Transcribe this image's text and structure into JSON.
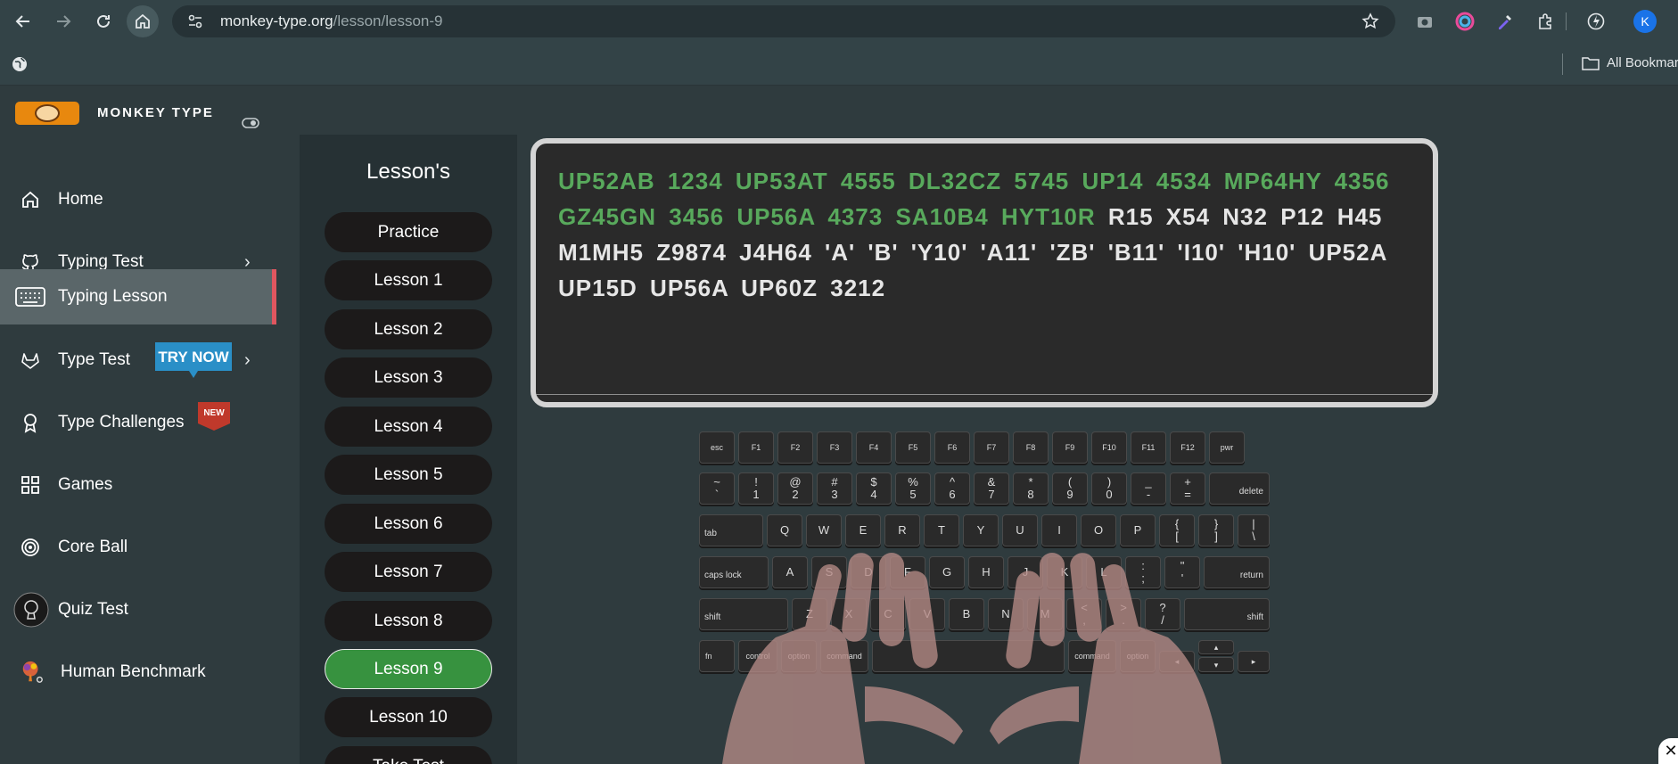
{
  "browser": {
    "url_host": "monkey-type.org",
    "url_path": "/lesson/lesson-9",
    "bookmarks_label": "All Bookmarks",
    "profile_initial": "K"
  },
  "sidebar": {
    "brand": "MONKEY TYPE",
    "items": [
      {
        "label": "Home",
        "icon": "home-icon"
      },
      {
        "label": "Typing Test",
        "icon": "github-icon",
        "has_chevron": true
      },
      {
        "label": "Typing Lesson",
        "icon": "keyboard-icon",
        "active": true
      },
      {
        "label": "Type Test",
        "icon": "gitlab-icon",
        "has_chevron": true,
        "badge": "TRY NOW"
      },
      {
        "label": "Type Challenges",
        "icon": "award-icon",
        "badge": "NEW"
      },
      {
        "label": "Games",
        "icon": "grid-icon"
      },
      {
        "label": "Core Ball",
        "icon": "target-icon"
      },
      {
        "label": "Quiz Test",
        "icon": "quiz-avatar-icon"
      },
      {
        "label": "Human Benchmark",
        "icon": "brain-icon"
      }
    ]
  },
  "lessons": {
    "title": "Lesson's",
    "buttons": [
      "Practice",
      "Lesson 1",
      "Lesson 2",
      "Lesson 3",
      "Lesson 4",
      "Lesson 5",
      "Lesson 6",
      "Lesson 7",
      "Lesson 8",
      "Lesson 9",
      "Lesson 10",
      "Take Test"
    ],
    "active": "Lesson 9"
  },
  "typing": {
    "typed": "UP52AB 1234 UP53AT 4555 DL32CZ 5745 UP14 4534 MP64HY 4356 GZ45GN 3456 UP56A 4373 SA10B4 HYT10R",
    "remaining": " R15 X54 N32 P12 H45 M1MH5 Z9874 J4H64 'A' 'B' 'Y10' 'A11' 'ZB' 'B11' 'I10' 'H10' UP52A UP15D UP56A UP60Z 3212"
  },
  "keyboard": {
    "function_row": [
      "esc",
      "F1",
      "F2",
      "F3",
      "F4",
      "F5",
      "F6",
      "F7",
      "F8",
      "F9",
      "F10",
      "F11",
      "F12",
      "pwr"
    ],
    "number_row": [
      [
        "~",
        "`"
      ],
      [
        "!",
        "1"
      ],
      [
        "@",
        "2"
      ],
      [
        "#",
        "3"
      ],
      [
        "$",
        "4"
      ],
      [
        "%",
        "5"
      ],
      [
        "^",
        "6"
      ],
      [
        "&",
        "7"
      ],
      [
        "*",
        "8"
      ],
      [
        "(",
        "9"
      ],
      [
        ")",
        "0"
      ],
      [
        "_",
        "-"
      ],
      [
        "+",
        "="
      ]
    ],
    "delete": "delete",
    "tab": "tab",
    "qwerty_row": [
      "Q",
      "W",
      "E",
      "R",
      "T",
      "Y",
      "U",
      "I",
      "O",
      "P"
    ],
    "qwerty_extra": [
      [
        "{",
        "["
      ],
      [
        "}",
        "]"
      ],
      [
        "|",
        "\\"
      ]
    ],
    "caps": "caps lock",
    "home_row": [
      "A",
      "S",
      "D",
      "F",
      "G",
      "H",
      "J",
      "K",
      "L"
    ],
    "home_extra": [
      [
        ":",
        ";"
      ],
      [
        "\"",
        "'"
      ]
    ],
    "return": "return",
    "shift": "shift",
    "bottom_letters": [
      "Z",
      "X",
      "C",
      "V",
      "B",
      "N",
      "M"
    ],
    "bottom_extra": [
      [
        "<",
        ","
      ],
      [
        ">",
        "."
      ],
      [
        "?",
        "/"
      ]
    ],
    "modifiers": [
      "fn",
      "control",
      "option",
      "command",
      "command",
      "option"
    ]
  },
  "colors": {
    "accent_green": "#37923f",
    "typed_text": "#58a95c",
    "active_marker": "#e0565f"
  }
}
